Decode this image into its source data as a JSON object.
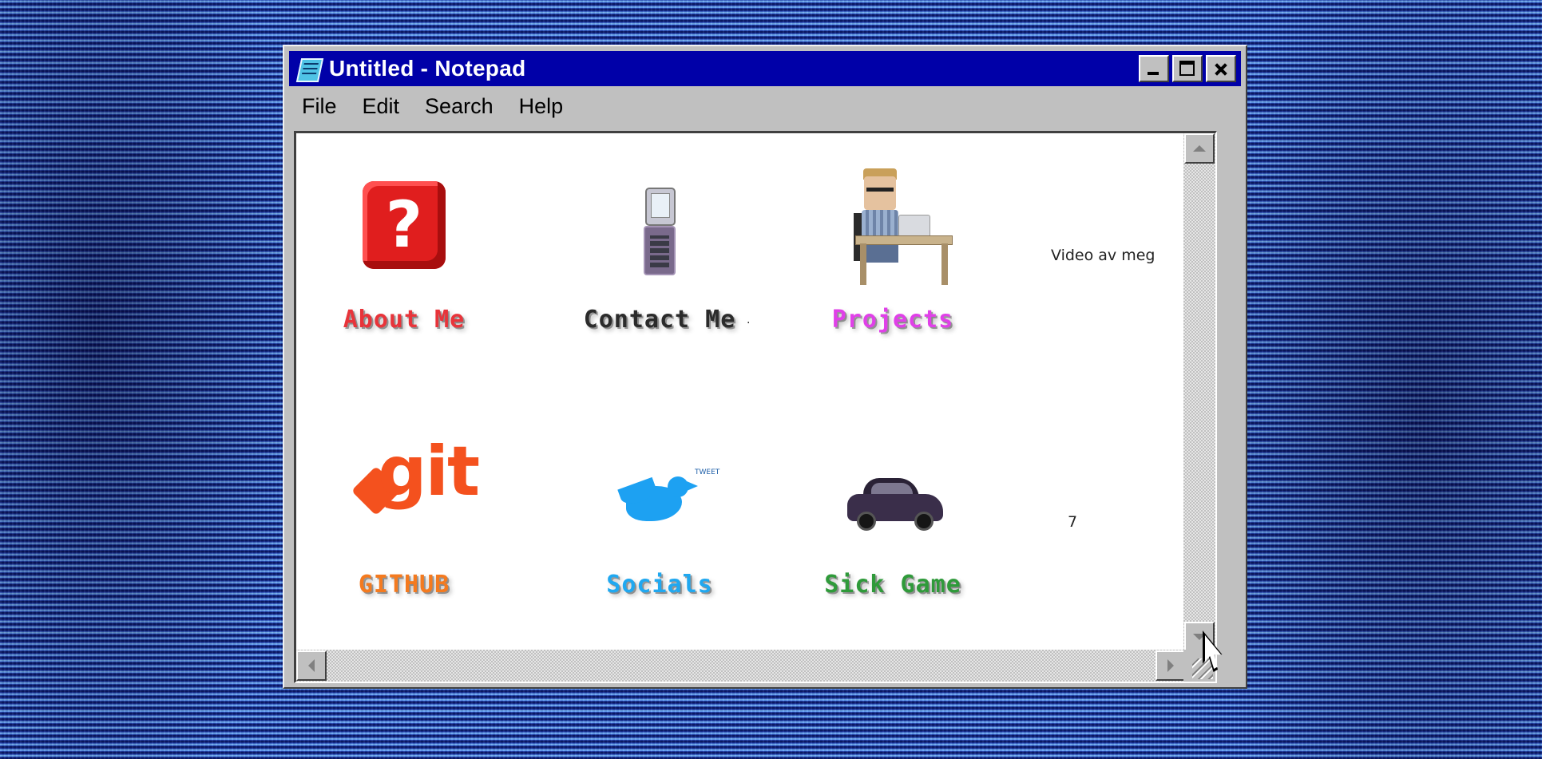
{
  "window": {
    "title": "Untitled - Notepad",
    "app_icon": "notepad-icon",
    "controls": [
      "minimize",
      "maximize",
      "close"
    ]
  },
  "menu": {
    "items": [
      {
        "label": "File"
      },
      {
        "label": "Edit"
      },
      {
        "label": "Search"
      },
      {
        "label": "Help"
      }
    ]
  },
  "tiles": [
    {
      "label": "About Me",
      "icon": "question-block-icon",
      "color": "#e8343a"
    },
    {
      "label": "Contact Me",
      "icon": "flip-phone-icon",
      "color": "#2b2b2b"
    },
    {
      "label": "Projects",
      "icon": "developer-at-desk-icon",
      "color": "#e040e8"
    },
    {
      "label": "GITHUB",
      "icon": "git-logo-icon",
      "color": "#f47a1f"
    },
    {
      "label": "Socials",
      "icon": "twitter-bird-icon",
      "color": "#20a8f0"
    },
    {
      "label": "Sick Game",
      "icon": "car-icon",
      "color": "#2f9a3a"
    }
  ],
  "side_text": {
    "video": "Video av meg",
    "number": "7",
    "dot": "."
  },
  "bird_caption": "TWEET",
  "background": {
    "accent": "#16288c",
    "highlight": "#8fd3ff"
  },
  "titlebar_color": "#0000a8"
}
